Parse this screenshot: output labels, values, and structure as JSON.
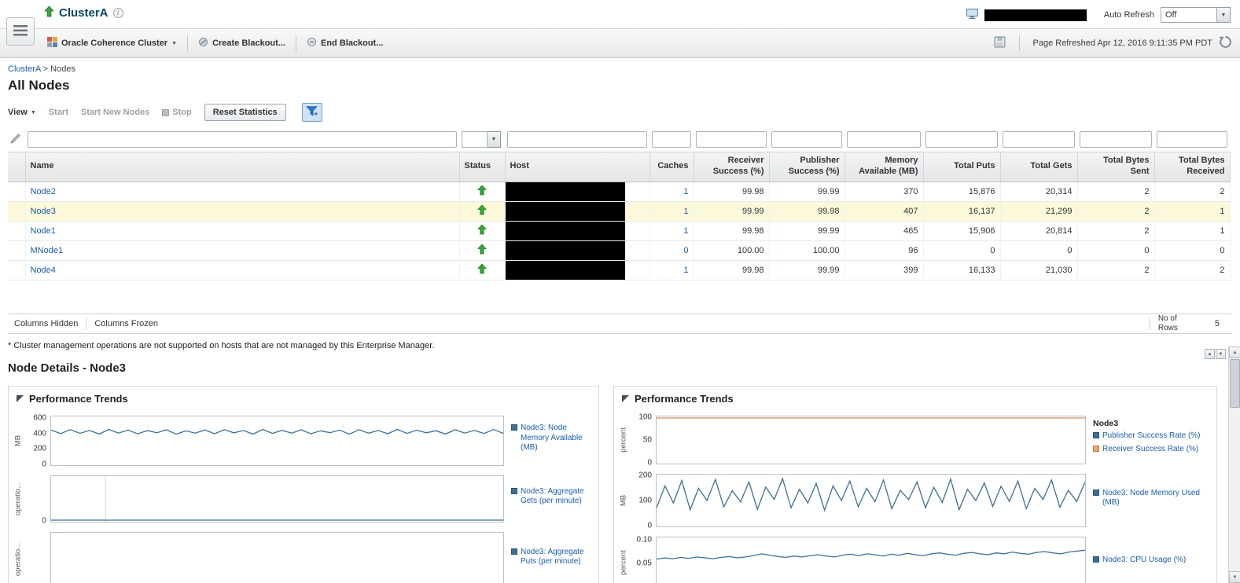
{
  "header": {
    "title": "ClusterA",
    "auto_refresh": {
      "label": "Auto Refresh",
      "value": "Off"
    }
  },
  "toolbar": {
    "cluster_menu": "Oracle Coherence Cluster",
    "create_blackout": "Create Blackout...",
    "end_blackout": "End Blackout...",
    "page_refreshed": "Page Refreshed Apr 12, 2016 9:11:35 PM PDT"
  },
  "breadcrumb": {
    "root": "ClusterA",
    "separator": ">",
    "current": "Nodes"
  },
  "page": {
    "title": "All Nodes"
  },
  "actions": {
    "view": "View",
    "start": "Start",
    "start_new_nodes": "Start New Nodes",
    "stop": "Stop",
    "reset_statistics": "Reset Statistics"
  },
  "table": {
    "columns": [
      "Name",
      "Status",
      "Host",
      "Caches",
      "Receiver Success (%)",
      "Publisher Success (%)",
      "Memory Available (MB)",
      "Total Puts",
      "Total Gets",
      "Total Bytes Sent",
      "Total Bytes Received"
    ],
    "rows": [
      {
        "name": "Node2",
        "caches": "1",
        "receiver_success": "99.98",
        "publisher_success": "99.99",
        "memory_available": "370",
        "total_puts": "15,876",
        "total_gets": "20,314",
        "total_bytes_sent": "2",
        "total_bytes_received": "2"
      },
      {
        "name": "Node3",
        "caches": "1",
        "receiver_success": "99.99",
        "publisher_success": "99.98",
        "memory_available": "407",
        "total_puts": "16,137",
        "total_gets": "21,299",
        "total_bytes_sent": "2",
        "total_bytes_received": "1"
      },
      {
        "name": "Node1",
        "caches": "1",
        "receiver_success": "99.98",
        "publisher_success": "99.99",
        "memory_available": "465",
        "total_puts": "15,906",
        "total_gets": "20,814",
        "total_bytes_sent": "2",
        "total_bytes_received": "1"
      },
      {
        "name": "MNode1",
        "caches": "0",
        "receiver_success": "100.00",
        "publisher_success": "100.00",
        "memory_available": "96",
        "total_puts": "0",
        "total_gets": "0",
        "total_bytes_sent": "0",
        "total_bytes_received": "0"
      },
      {
        "name": "Node4",
        "caches": "1",
        "receiver_success": "99.98",
        "publisher_success": "99.99",
        "memory_available": "399",
        "total_puts": "16,133",
        "total_gets": "21,030",
        "total_bytes_sent": "2",
        "total_bytes_received": "2"
      }
    ],
    "footer": {
      "columns_hidden": "Columns Hidden",
      "columns_frozen": "Columns Frozen",
      "rows_label": "No of Rows",
      "rows_value": "5"
    }
  },
  "note": "* Cluster management operations are not supported on hosts that are not managed by this Enterprise Manager.",
  "details": {
    "title": "Node Details - Node3"
  },
  "panels": {
    "left": {
      "title": "Performance Trends"
    },
    "right": {
      "title": "Performance Trends"
    }
  },
  "colors": {
    "link": "#1a5db0",
    "status_up": "#3aa53a",
    "row_highlight": "#fbf9da",
    "chart_line": "#3d6f96",
    "chart_line_alt": "#f0a470"
  },
  "chart_data": [
    {
      "id": "node-memory-available",
      "type": "line",
      "ylabel": "MB",
      "yticks": [
        "600",
        "400",
        "200",
        "0"
      ],
      "ymin": 0,
      "ymax": 620,
      "series": [
        {
          "name": "Node3: Node Memory Available (MB)",
          "color": "#3d6f96",
          "values": [
            455,
            408,
            462,
            412,
            450,
            402,
            465,
            415,
            455,
            405,
            448,
            420,
            460,
            400,
            445,
            415,
            457,
            406,
            462,
            418,
            450,
            401,
            464,
            410,
            452,
            415,
            460,
            405,
            446,
            420,
            455,
            400,
            461,
            414,
            450,
            406,
            465,
            410,
            454,
            419,
            447,
            402,
            460,
            415,
            451,
            409,
            463,
            412
          ]
        }
      ]
    },
    {
      "id": "aggregate-gets",
      "type": "line",
      "ylabel": "operatio...",
      "yticks": [
        "0"
      ],
      "ymin": 0,
      "ymax": 1,
      "vlines": [
        0.12
      ],
      "series": [
        {
          "name": "Node3: Aggregate Gets (per minute)",
          "color": "#3d6f96",
          "values": [
            0,
            0
          ]
        }
      ]
    },
    {
      "id": "aggregate-puts",
      "type": "line",
      "ylabel": "operatio...",
      "yticks": [],
      "ymin": 0,
      "ymax": 1,
      "series": [
        {
          "name": "Node3: Aggregate Puts (per minute)",
          "color": "#3d6f96",
          "values": [
            0,
            0
          ]
        }
      ]
    },
    {
      "id": "success-rates",
      "type": "line",
      "ylabel": "percent",
      "yticks": [
        "100",
        "50",
        "0"
      ],
      "ymin": 0,
      "ymax": 100,
      "legend_title": "Node3",
      "series": [
        {
          "name": "Publisher Success Rate (%)",
          "color": "#3d6f96",
          "values": [
            100,
            100
          ]
        },
        {
          "name": "Receiver Success Rate (%)",
          "color": "#f0a470",
          "values": [
            100,
            100
          ]
        }
      ]
    },
    {
      "id": "node-memory-used",
      "type": "line",
      "ylabel": "MB",
      "yticks": [
        "200",
        "100",
        "0"
      ],
      "ymin": 0,
      "ymax": 200,
      "series": [
        {
          "name": "Node3: Node Memory Used (MB)",
          "color": "#3d6f96",
          "values": [
            70,
            160,
            90,
            182,
            62,
            150,
            100,
            186,
            74,
            140,
            95,
            176,
            64,
            155,
            104,
            190,
            70,
            146,
            90,
            170,
            60,
            160,
            100,
            180,
            74,
            150,
            95,
            184,
            66,
            142,
            104,
            176,
            70,
            154,
            92,
            188,
            62,
            146,
            100,
            172,
            76,
            158,
            96,
            180,
            66,
            150,
            104,
            184,
            72,
            142,
            96,
            176
          ]
        }
      ]
    },
    {
      "id": "cpu-usage",
      "type": "line",
      "ylabel": "percent",
      "yticks": [
        "0.10",
        "0.05"
      ],
      "ymin": 0,
      "ymax": 0.105,
      "series": [
        {
          "name": "Node3: CPU Usage (%)",
          "color": "#3d6f96",
          "values": [
            0.06,
            0.063,
            0.061,
            0.064,
            0.062,
            0.065,
            0.063,
            0.061,
            0.064,
            0.066,
            0.063,
            0.065,
            0.068,
            0.072,
            0.069,
            0.066,
            0.064,
            0.067,
            0.065,
            0.068,
            0.07,
            0.067,
            0.065,
            0.069,
            0.071,
            0.068,
            0.072,
            0.07,
            0.067,
            0.071,
            0.069,
            0.073,
            0.07,
            0.068,
            0.072,
            0.074,
            0.071,
            0.069,
            0.073,
            0.075,
            0.072,
            0.07,
            0.074,
            0.072,
            0.076,
            0.073,
            0.071,
            0.075,
            0.077,
            0.074,
            0.072,
            0.076,
            0.078,
            0.08
          ]
        }
      ]
    }
  ]
}
